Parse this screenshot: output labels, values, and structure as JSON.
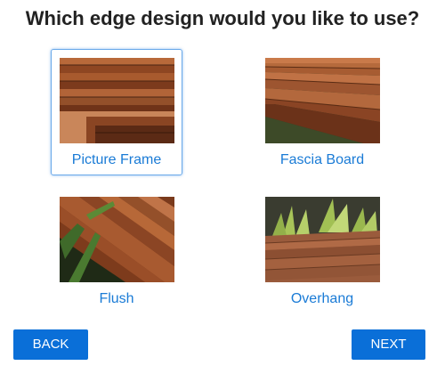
{
  "question": "Which edge design would you like to use?",
  "options": [
    {
      "label": "Picture Frame",
      "selected": true
    },
    {
      "label": "Fascia Board",
      "selected": false
    },
    {
      "label": "Flush",
      "selected": false
    },
    {
      "label": "Overhang",
      "selected": false
    }
  ],
  "buttons": {
    "back_label": "BACK",
    "next_label": "NEXT"
  },
  "colors": {
    "accent": "#0a6fd8",
    "label_text": "#1a7bd6",
    "selected_border": "#6aa9e9"
  }
}
